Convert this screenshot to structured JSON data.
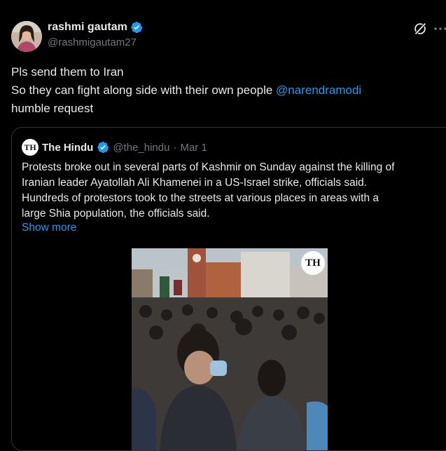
{
  "tweet": {
    "author": {
      "display_name": "rashmi gautam",
      "handle": "@rashmigautam27",
      "verified": true
    },
    "text_lines": [
      "Pls send them to Iran",
      "So they can fight along side with their own people ",
      "humble request"
    ],
    "mention": "@narendramodi",
    "icons": [
      "grok-icon",
      "more-icon"
    ]
  },
  "quote": {
    "logo_text": "TH",
    "display_name": "The Hindu",
    "handle": "@the_hindu",
    "separator": "·",
    "date": "Mar 1",
    "text_lines": [
      "Protests broke out in several parts of Kashmir on Sunday against the killing of",
      "Iranian leader Ayatollah Ali Khamenei in a US-Israel strike, officials said.",
      "Hundreds of protestors took to the streets at various places in areas with a",
      "large Shia population, the officials said."
    ],
    "show_more": "Show more",
    "media": {
      "badge": "TH"
    }
  },
  "colors": {
    "background": "#000000",
    "text": "#e7e9ea",
    "muted": "#71767b",
    "accent": "#1d9bf0",
    "border": "#2f3336"
  }
}
